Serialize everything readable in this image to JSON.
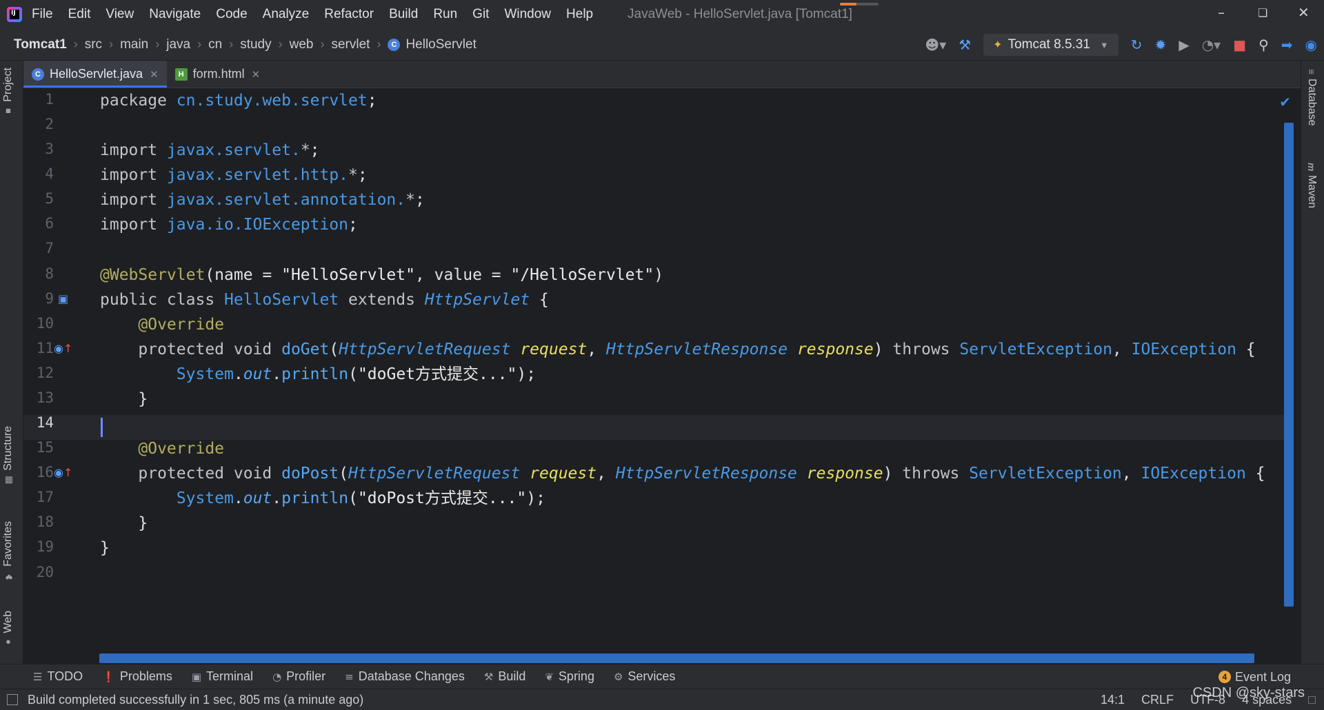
{
  "menu": {
    "items": [
      "File",
      "Edit",
      "View",
      "Navigate",
      "Code",
      "Analyze",
      "Refactor",
      "Build",
      "Run",
      "Git",
      "Window",
      "Help"
    ],
    "window_title": "JavaWeb - HelloServlet.java [Tomcat1]"
  },
  "breadcrumb": [
    "Tomcat1",
    "src",
    "main",
    "java",
    "cn",
    "study",
    "web",
    "servlet",
    "HelloServlet"
  ],
  "run_config": "Tomcat 8.5.31",
  "tabs": [
    {
      "label": "HelloServlet.java",
      "active": true
    },
    {
      "label": "form.html",
      "active": false
    }
  ],
  "side_tabs": {
    "left": [
      "Project",
      "Structure",
      "Favorites",
      "Web"
    ],
    "right": [
      "Database",
      "Maven"
    ]
  },
  "editor": {
    "line_numbers": [
      "1",
      "2",
      "3",
      "4",
      "5",
      "6",
      "7",
      "8",
      "9",
      "10",
      "11",
      "12",
      "13",
      "14",
      "15",
      "16",
      "17",
      "18",
      "19",
      "20"
    ],
    "current_line": "14",
    "code": {
      "l1": {
        "kw": "package ",
        "pkg": "cn.study.web.servlet",
        "end": ";"
      },
      "l3": {
        "kw": "import ",
        "pkg": "javax.servlet.",
        "star": "*",
        "end": ";"
      },
      "l4": {
        "kw": "import ",
        "pkg": "javax.servlet.http.",
        "star": "*",
        "end": ";"
      },
      "l5": {
        "kw": "import ",
        "pkg": "javax.servlet.annotation.",
        "star": "*",
        "end": ";"
      },
      "l6": {
        "kw": "import ",
        "pkg": "java.io.IOException",
        "end": ";"
      },
      "l8": {
        "ann": "@WebServlet",
        "p1": "(name = ",
        "s1": "\"HelloServlet\"",
        "p2": ", value = ",
        "s2": "\"/HelloServlet\"",
        "p3": ")"
      },
      "l9": {
        "kw1": "public class ",
        "cls": "HelloServlet",
        "kw2": " extends ",
        "sup": "HttpServlet",
        "end": " {"
      },
      "l10": {
        "indent": "    ",
        "ann": "@Override"
      },
      "l11": {
        "indent": "    ",
        "kw": "protected void ",
        "meth": "doGet",
        "o": "(",
        "t1": "HttpServletRequest",
        "sp1": " ",
        "p1": "request",
        "c": ", ",
        "t2": "HttpServletResponse",
        "sp2": " ",
        "p2": "response",
        "cp": ")",
        "kw2": " throws ",
        "e1": "ServletException",
        "c2": ", ",
        "e2": "IOException",
        "end": " {"
      },
      "l12": {
        "indent": "        ",
        "cls": "System",
        "dot": ".",
        "field": "out",
        "dot2": ".",
        "meth": "println",
        "o": "(",
        "str": "\"doGet方式提交...\"",
        "end": ");"
      },
      "l13": {
        "indent": "    ",
        "end": "}"
      },
      "l15": {
        "indent": "    ",
        "ann": "@Override"
      },
      "l16": {
        "indent": "    ",
        "kw": "protected void ",
        "meth": "doPost",
        "o": "(",
        "t1": "HttpServletRequest",
        "sp1": " ",
        "p1": "request",
        "c": ", ",
        "t2": "HttpServletResponse",
        "sp2": " ",
        "p2": "response",
        "cp": ")",
        "kw2": " throws ",
        "e1": "ServletException",
        "c2": ", ",
        "e2": "IOException",
        "end": " {"
      },
      "l17": {
        "indent": "        ",
        "cls": "System",
        "dot": ".",
        "field": "out",
        "dot2": ".",
        "meth": "println",
        "o": "(",
        "str": "\"doPost方式提交...\"",
        "end": ");"
      },
      "l18": {
        "indent": "    ",
        "end": "}"
      },
      "l19": {
        "end": "}"
      }
    }
  },
  "bottom_tools": [
    "TODO",
    "Problems",
    "Terminal",
    "Profiler",
    "Database Changes",
    "Build",
    "Spring",
    "Services"
  ],
  "event_log": {
    "count": "4",
    "label": "Event Log"
  },
  "status": {
    "message": "Build completed successfully in 1 sec, 805 ms (a minute ago)",
    "position": "14:1",
    "line_sep": "CRLF",
    "encoding": "UTF-8",
    "indent": "4 spaces"
  },
  "watermark": "CSDN @sky-stars",
  "colors": {
    "accent": "#3574f0",
    "keyword": "#c1c3c9",
    "type": "#4a9ae8",
    "annotation": "#b3ae60",
    "param": "#e8e05e"
  }
}
